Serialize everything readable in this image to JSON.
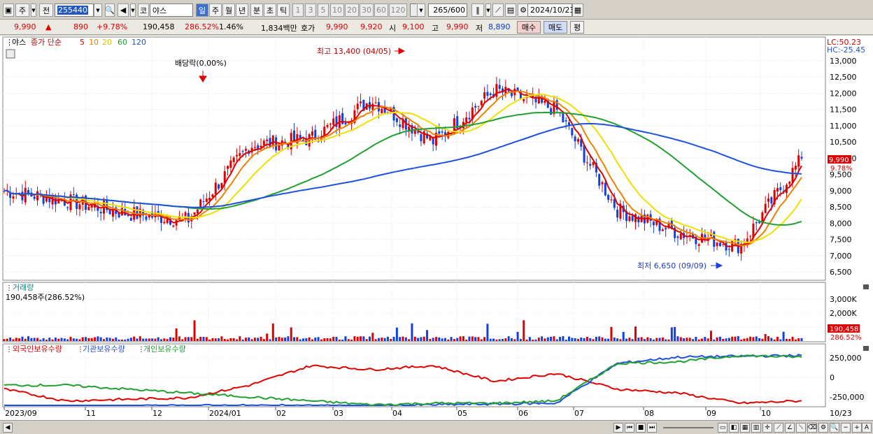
{
  "toolbar": {
    "market": "주",
    "type": "전",
    "code": "255440",
    "icon_chart_type": "코",
    "stock_name": "야스",
    "periods": [
      "일",
      "주",
      "월",
      "년",
      "분",
      "초",
      "틱"
    ],
    "selected_period": "일",
    "intervals": [
      "1",
      "3",
      "5",
      "10",
      "20",
      "30",
      "60",
      "120"
    ],
    "count": "265",
    "count_max": "/600",
    "date": "2024/10/23"
  },
  "quote": {
    "price": "9,990",
    "change_arrow": "▲",
    "change": "890",
    "change_pct": "+9.78%",
    "volume": "190,458",
    "volume_ratio": "286.52%",
    "turnover_pct": "1.46%",
    "amount": "1,834백만",
    "label_bid": "호가",
    "ask": "9,990",
    "bid": "9,920",
    "label_open": "시",
    "open": "9,100",
    "label_high": "고",
    "high": "9,990",
    "label_low": "저",
    "low": "8,890",
    "buy_button": "매수",
    "sell_button": "매도",
    "eval_button": "평"
  },
  "price_panel": {
    "name": "야스",
    "ma_label": "종가 단순",
    "ma_periods": [
      "5",
      "10",
      "20",
      "60",
      "120"
    ],
    "ma_colors": [
      "#e00000",
      "#f08000",
      "#f0e000",
      "#20a030",
      "#2050e0"
    ],
    "lc": "LC:50.23",
    "hc": "HC:-25.45",
    "annotation_dividend": "배당락(0.00%)",
    "annotation_high": "최고 13,400 (04/05)",
    "annotation_low": "최저 6,650 (09/09)",
    "current_price_tag": "9,990",
    "current_pct_tag": "9.78%",
    "y_ticks": [
      "13,000",
      "12,500",
      "12,000",
      "11,500",
      "11,000",
      "10,500",
      "10,000",
      "9,500",
      "9,000",
      "8,500",
      "8,000",
      "7,500",
      "7,000",
      "6,500"
    ]
  },
  "volume_panel": {
    "title": "거래량",
    "value": "190,458주(286.52%)",
    "y_ticks": [
      "3,000K",
      "2,000K",
      "1,000K"
    ],
    "tag_value": "190,458",
    "tag_pct": "286.52%"
  },
  "holding_panel": {
    "series": [
      "외국인보유수량",
      "기관보유수량",
      "개인보유수량"
    ],
    "colors": [
      "#e00000",
      "#2050e0",
      "#20a030"
    ],
    "y_ticks": [
      "250,000",
      "0",
      "-250,000"
    ]
  },
  "x_axis": {
    "labels": [
      "2023/09",
      "11",
      "12",
      "2024/01",
      "02",
      "03",
      "04",
      "05",
      "06",
      "07",
      "08",
      "09",
      "10"
    ],
    "end_label": "10/23"
  },
  "chart_data": {
    "type": "line",
    "x_unit": "month",
    "close_price_path": [
      [
        "2023/09",
        9000
      ],
      [
        "2023/10",
        8700
      ],
      [
        "2023/11",
        8300
      ],
      [
        "2023/12",
        8100
      ],
      [
        "2024/01",
        10400
      ],
      [
        "2024/02",
        10600
      ],
      [
        "2024/03",
        11800
      ],
      [
        "2024/04",
        10500
      ],
      [
        "2024/05",
        12100
      ],
      [
        "2024/06",
        11500
      ],
      [
        "2024/07",
        8400
      ],
      [
        "2024/08",
        7700
      ],
      [
        "2024/09",
        7300
      ],
      [
        "2024/10",
        9990
      ]
    ],
    "ylim": [
      6400,
      13400
    ]
  }
}
